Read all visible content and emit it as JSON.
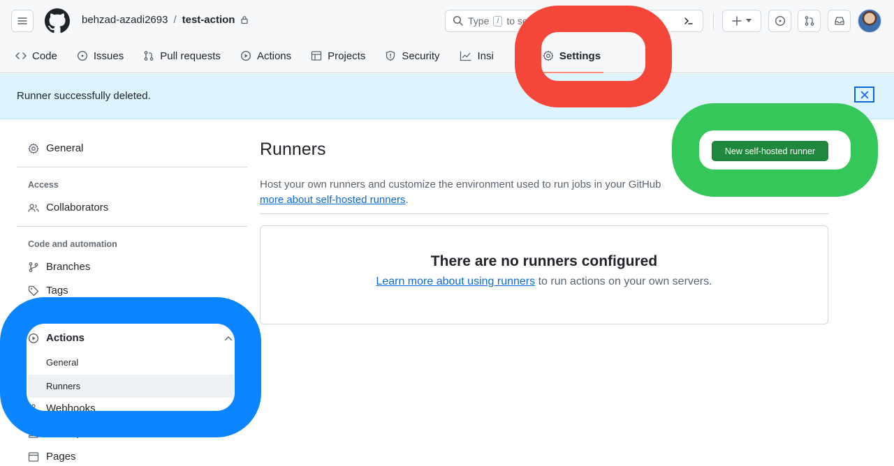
{
  "header": {
    "owner": "behzad-azadi2693",
    "separator": "/",
    "repo": "test-action",
    "search": {
      "prefix": "Type",
      "key": "/",
      "rest": "to se"
    }
  },
  "tabs": [
    {
      "label": "Code",
      "icon": "code-icon"
    },
    {
      "label": "Issues",
      "icon": "issue-icon"
    },
    {
      "label": "Pull requests",
      "icon": "pull-request-icon"
    },
    {
      "label": "Actions",
      "icon": "play-icon"
    },
    {
      "label": "Projects",
      "icon": "table-icon"
    },
    {
      "label": "Security",
      "icon": "shield-icon"
    },
    {
      "label": "Insi",
      "icon": "graph-icon"
    },
    {
      "label": "Settings",
      "icon": "gear-icon",
      "selected": true
    }
  ],
  "flash": {
    "message": "Runner successfully deleted."
  },
  "sidebar": {
    "general": "General",
    "access_heading": "Access",
    "collaborators": "Collaborators",
    "code_heading": "Code and automation",
    "branches": "Branches",
    "tags": "Tags",
    "actions": "Actions",
    "actions_sub": [
      "General",
      "Runners"
    ],
    "webhooks": "Webhooks",
    "codespaces": "Codespaces",
    "pages": "Pages"
  },
  "main": {
    "title": "Runners",
    "new_button": "New self-hosted runner",
    "desc_text": "Host your own runners and customize the environment used to run jobs in your GitHub ",
    "desc_link": "more about self-hosted runners",
    "desc_end": ".",
    "empty_title": "There are no runners configured",
    "empty_link": "Learn more about using runners",
    "empty_rest": " to run actions on your own servers."
  },
  "colors": {
    "primary_button": "#1f883d",
    "flash_bg": "#ddf4ff",
    "highlight_red": "#f4473a",
    "highlight_green": "#35c759",
    "highlight_blue": "#0a84ff"
  }
}
